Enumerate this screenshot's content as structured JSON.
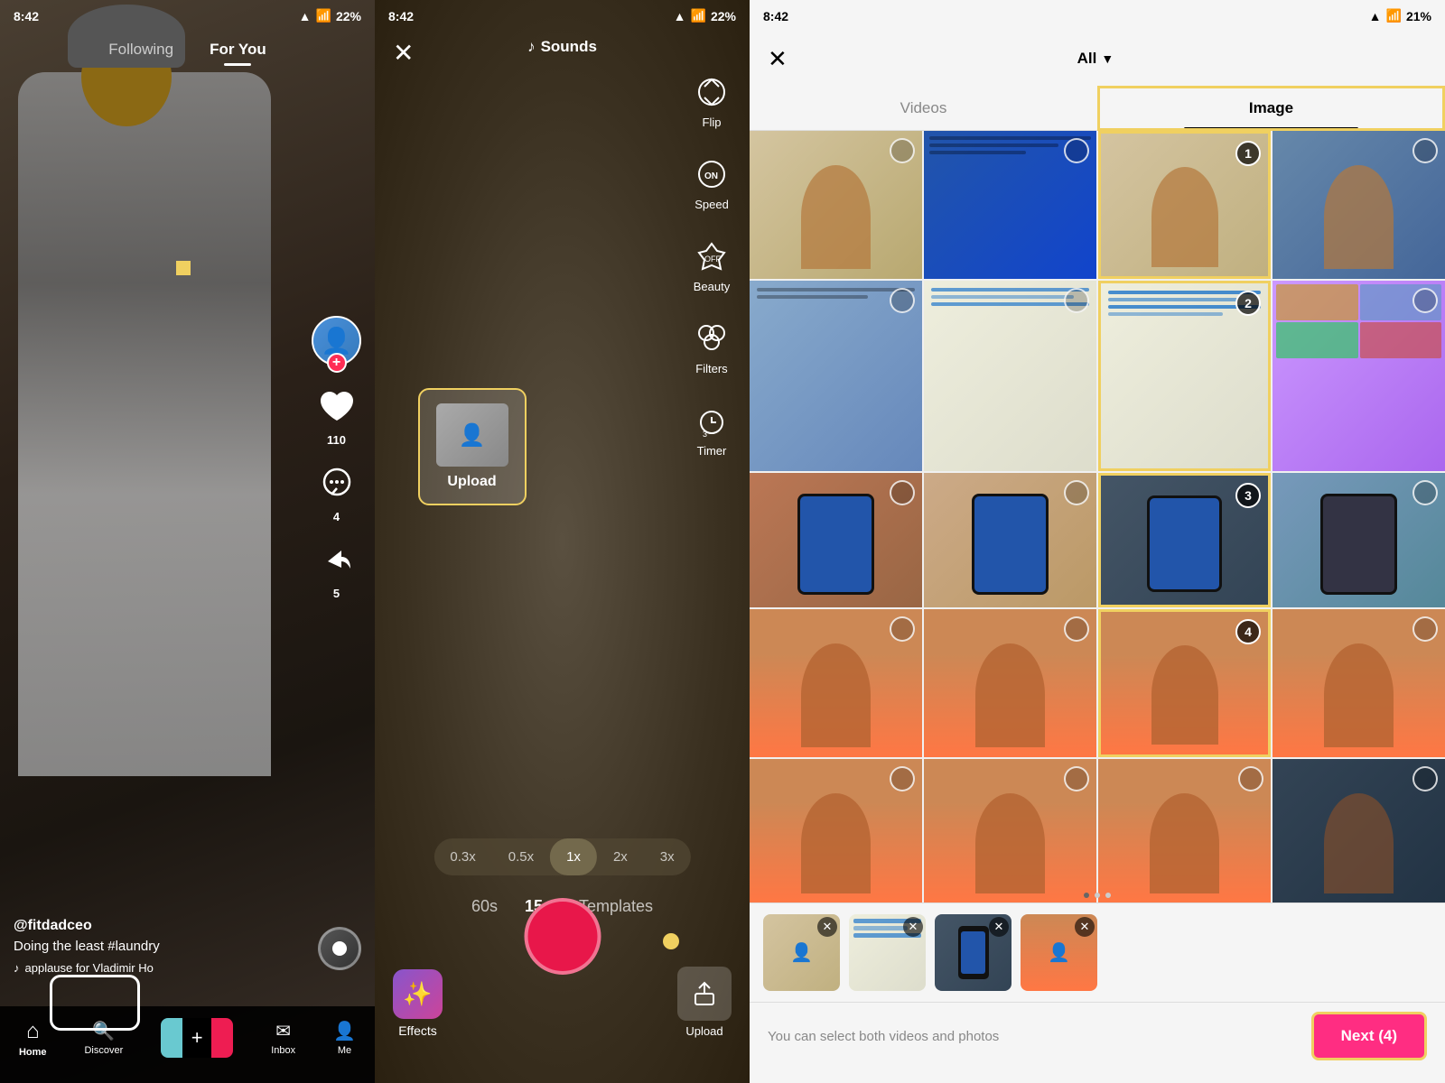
{
  "panel1": {
    "status": {
      "time": "8:42",
      "battery": "22%"
    },
    "nav": {
      "following": "Following",
      "for_you": "For You"
    },
    "actions": {
      "likes": "110",
      "comments": "4",
      "shares": "5"
    },
    "user": "@fitdadceo",
    "caption": "Doing the least #laundry",
    "sound": "applause for Vladimir Ho",
    "bottom_nav": [
      {
        "label": "Home",
        "icon": "⌂"
      },
      {
        "label": "Discover",
        "icon": "🔍"
      },
      {
        "label": "",
        "icon": "+"
      },
      {
        "label": "Inbox",
        "icon": "✉"
      },
      {
        "label": "Me",
        "icon": "👤"
      }
    ]
  },
  "panel2": {
    "status": {
      "time": "8:42",
      "battery": "22%"
    },
    "sounds_label": "Sounds",
    "controls": [
      "Flip",
      "Speed",
      "Beauty",
      "Filters",
      "Timer"
    ],
    "upload_label": "Upload",
    "speed_options": [
      "0.3x",
      "0.5x",
      "1x",
      "2x",
      "3x"
    ],
    "active_speed": "1x",
    "durations": [
      "60s",
      "15s",
      "Templates"
    ],
    "active_duration": "15s",
    "bottom_items": [
      "Effects",
      "Upload"
    ]
  },
  "panel3": {
    "status": {
      "time": "8:42",
      "battery": "21%"
    },
    "filter": "All",
    "tabs": [
      "Videos",
      "Image"
    ],
    "active_tab": "Image",
    "selected_count": 4,
    "hint": "You can select both videos and photos",
    "next_btn": "Next (4)",
    "selection_numbers": [
      1,
      2,
      3,
      4
    ],
    "grid_rows": 5,
    "grid_cols": 4
  }
}
